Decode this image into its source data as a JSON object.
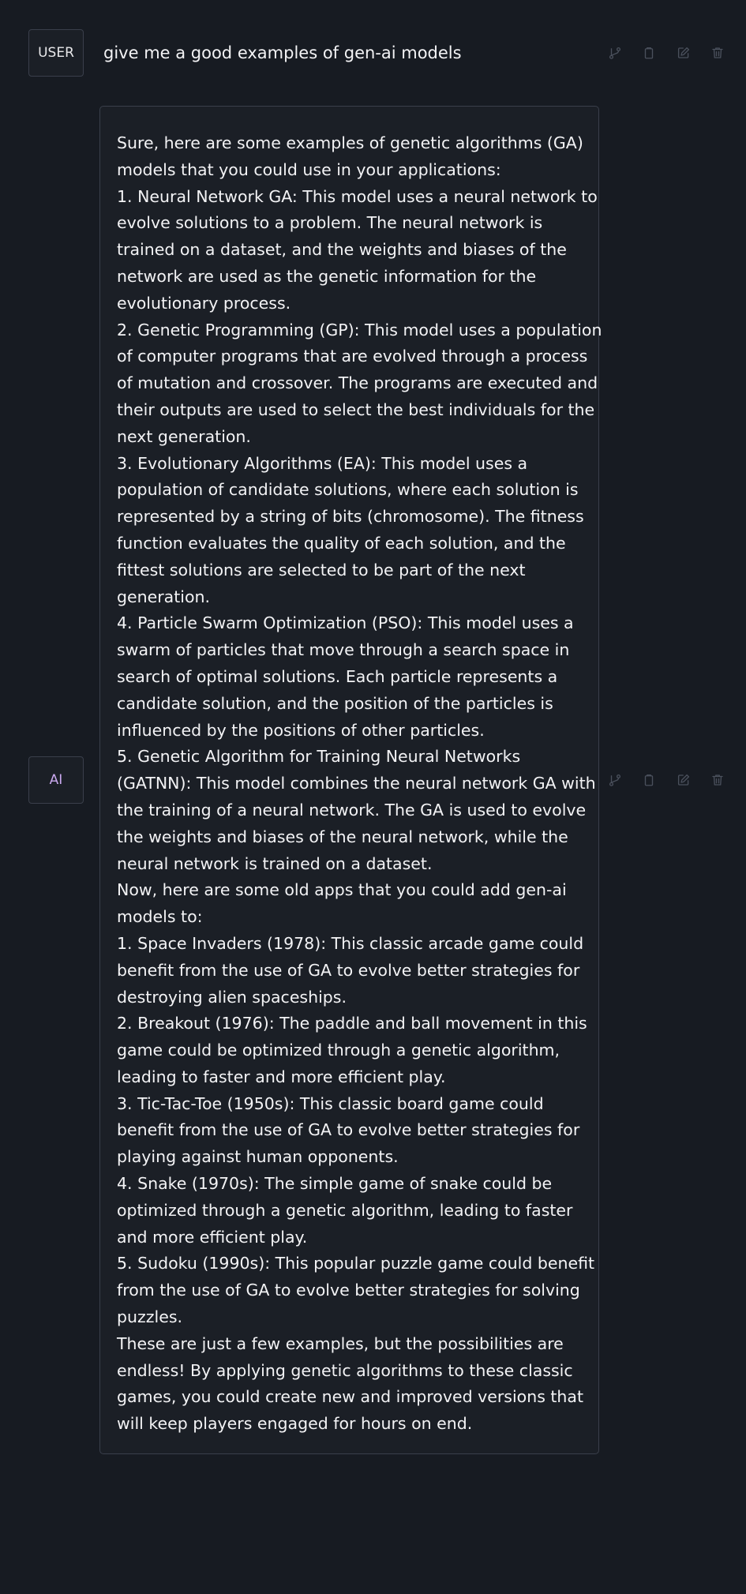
{
  "messages": {
    "user": {
      "role": "USER",
      "text": "give me a good examples of gen-ai models"
    },
    "ai": {
      "role": "AI",
      "lines": [
        "Sure, here are some examples of genetic algorithms (GA)",
        "models that you could use in your applications:",
        "1. Neural Network GA: This model uses a neural network to",
        "evolve solutions to a problem. The neural network is",
        "trained on a dataset, and the weights and biases of the",
        "network are used as the genetic information for the",
        "evolutionary process.",
        "2. Genetic Programming (GP): This model uses a population",
        "of computer programs that are evolved through a process",
        "of mutation and crossover. The programs are executed and",
        "their outputs are used to select the best individuals for the",
        "next generation.",
        "3. Evolutionary Algorithms (EA): This model uses a",
        "population of candidate solutions, where each solution is",
        "represented by a string of bits (chromosome). The fitness",
        "function evaluates the quality of each solution, and the",
        "fittest solutions are selected to be part of the next",
        "generation.",
        "4. Particle Swarm Optimization (PSO): This model uses a",
        "swarm of particles that move through a search space in",
        "search of optimal solutions. Each particle represents a",
        "candidate solution, and the position of the particles is",
        "influenced by the positions of other particles.",
        "5. Genetic Algorithm for Training Neural Networks",
        "(GATNN): This model combines the neural network GA with",
        "the training of a neural network. The GA is used to evolve",
        "the weights and biases of the neural network, while the",
        "neural network is trained on a dataset.",
        "Now, here are some old apps that you could add gen-ai",
        "models to:",
        "1. Space Invaders (1978): This classic arcade game could",
        "benefit from the use of GA to evolve better strategies for",
        "destroying alien spaceships.",
        "2. Breakout (1976): The paddle and ball movement in this",
        "game could be optimized through a genetic algorithm,",
        "leading to faster and more efficient play.",
        "3. Tic-Tac-Toe (1950s): This classic board game could",
        "benefit from the use of GA to evolve better strategies for",
        "playing against human opponents.",
        "4. Snake (1970s): The simple game of snake could be",
        "optimized through a genetic algorithm, leading to faster",
        "and more efficient play.",
        "5. Sudoku (1990s): This popular puzzle game could benefit",
        "from the use of GA to evolve better strategies for solving",
        "puzzles.",
        "These are just a few examples, but the possibilities are",
        "endless! By applying genetic algorithms to these classic",
        "games, you could create new and improved versions that",
        "will keep players engaged for hours on end."
      ]
    }
  },
  "actions": [
    {
      "name": "branch",
      "icon": "branch-icon"
    },
    {
      "name": "copy",
      "icon": "clipboard-icon"
    },
    {
      "name": "edit",
      "icon": "edit-icon"
    },
    {
      "name": "delete",
      "icon": "trash-icon"
    }
  ],
  "colors": {
    "background": "#171b22",
    "bubble": "#1b1f26",
    "border": "#3a3f4b",
    "ai_role": "#c9a8ee",
    "icon": "#4a505c"
  }
}
